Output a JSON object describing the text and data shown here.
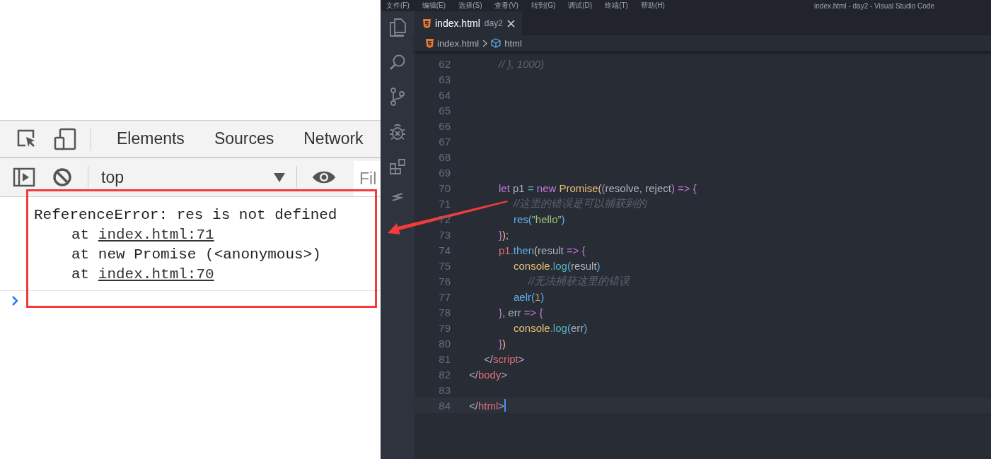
{
  "devtools": {
    "tabs": [
      {
        "label": "Elements"
      },
      {
        "label": "Sources"
      },
      {
        "label": "Network"
      }
    ],
    "toolbar": {
      "context": "top",
      "filter_placeholder": "Fil"
    },
    "console": {
      "message": "ReferenceError: res is not defined",
      "stack": [
        {
          "prefix": "at ",
          "link": "index.html:71"
        },
        {
          "prefix": "at new Promise (<anonymous>)"
        },
        {
          "prefix": "at ",
          "link": "index.html:70"
        }
      ]
    }
  },
  "vscode": {
    "menu": [
      "文件(F)",
      "编辑(E)",
      "选择(S)",
      "查看(V)",
      "转到(G)",
      "调试(D)",
      "终端(T)",
      "帮助(H)"
    ],
    "title": "index.html - day2 - Visual Studio Code",
    "tabs": [
      {
        "label": "index.html",
        "description": "day2",
        "selected": true
      }
    ],
    "breadcrumb": [
      {
        "label": "index.html",
        "kind": "file"
      },
      {
        "label": "html",
        "kind": "element"
      }
    ],
    "lines": [
      {
        "number": "62",
        "current": false,
        "tokens": [
          {
            "text": "\t\t// }, 1000)",
            "kind": "comment"
          }
        ]
      },
      {
        "number": "63",
        "current": false
      },
      {
        "number": "64",
        "current": false
      },
      {
        "number": "65",
        "current": false
      },
      {
        "number": "66",
        "current": false
      },
      {
        "number": "67",
        "current": false
      },
      {
        "number": "68",
        "current": false
      },
      {
        "number": "69",
        "current": false
      },
      {
        "number": "70",
        "current": false,
        "tokens": [
          {
            "text": "\t\tlet",
            "kind": "keyword"
          },
          {
            "text": " p1 ",
            "kind": "plain"
          },
          {
            "text": "=",
            "kind": "operator"
          },
          {
            "text": " new",
            "kind": "keyword"
          },
          {
            "text": " Promise",
            "kind": "class"
          },
          {
            "text": "(",
            "kind": "class"
          },
          {
            "text": "(",
            "kind": "keyword"
          },
          {
            "text": "resolve, reject",
            "kind": "plain"
          },
          {
            "text": ")",
            "kind": "keyword"
          },
          {
            "text": " =>",
            "kind": "keyword"
          },
          {
            "text": " {",
            "kind": "keyword"
          }
        ]
      },
      {
        "number": "71",
        "current": false,
        "tokens": [
          {
            "text": "\t\t\t//这里的错误是可以捕获到的",
            "kind": "comment"
          }
        ]
      },
      {
        "number": "72",
        "current": false,
        "tokens": [
          {
            "text": "\t\t\tres",
            "kind": "function"
          },
          {
            "text": "(",
            "kind": "function"
          },
          {
            "text": "”hello”",
            "kind": "string"
          },
          {
            "text": ")",
            "kind": "function"
          }
        ]
      },
      {
        "number": "73",
        "current": false,
        "tokens": [
          {
            "text": "\t\t}",
            "kind": "keyword"
          },
          {
            "text": ")",
            "kind": "class"
          },
          {
            "text": ";",
            "kind": "plain"
          }
        ]
      },
      {
        "number": "74",
        "current": false,
        "tokens": [
          {
            "text": "\t\tp1",
            "kind": "tag"
          },
          {
            "text": ".then",
            "kind": "function"
          },
          {
            "text": "(",
            "kind": "class"
          },
          {
            "text": "result ",
            "kind": "plain"
          },
          {
            "text": "=>",
            "kind": "keyword"
          },
          {
            "text": " {",
            "kind": "keyword"
          }
        ]
      },
      {
        "number": "75",
        "current": false,
        "tokens": [
          {
            "text": "\t\t\tconsole",
            "kind": "class"
          },
          {
            "text": ".log",
            "kind": "operator"
          },
          {
            "text": "(",
            "kind": "function"
          },
          {
            "text": "result",
            "kind": "plain"
          },
          {
            "text": ")",
            "kind": "function"
          }
        ]
      },
      {
        "number": "76",
        "current": false,
        "tokens": [
          {
            "text": "\t\t\t\t//无法捕获这里的错误",
            "kind": "comment"
          }
        ]
      },
      {
        "number": "77",
        "current": false,
        "tokens": [
          {
            "text": "\t\t\taelr",
            "kind": "function"
          },
          {
            "text": "(",
            "kind": "function"
          },
          {
            "text": "1",
            "kind": "number"
          },
          {
            "text": ")",
            "kind": "function"
          }
        ]
      },
      {
        "number": "78",
        "current": false,
        "tokens": [
          {
            "text": "\t\t}",
            "kind": "keyword"
          },
          {
            "text": ", err ",
            "kind": "plain"
          },
          {
            "text": "=>",
            "kind": "keyword"
          },
          {
            "text": " {",
            "kind": "keyword"
          }
        ]
      },
      {
        "number": "79",
        "current": false,
        "tokens": [
          {
            "text": "\t\t\tconsole",
            "kind": "class"
          },
          {
            "text": ".log",
            "kind": "operator"
          },
          {
            "text": "(",
            "kind": "function"
          },
          {
            "text": "err",
            "kind": "plain"
          },
          {
            "text": ")",
            "kind": "function"
          }
        ]
      },
      {
        "number": "80",
        "current": false,
        "tokens": [
          {
            "text": "\t\t}",
            "kind": "keyword"
          },
          {
            "text": ")",
            "kind": "class"
          }
        ]
      },
      {
        "number": "81",
        "current": false,
        "tokens": [
          {
            "text": "\t</",
            "kind": "plain"
          },
          {
            "text": "script",
            "kind": "tag"
          },
          {
            "text": ">",
            "kind": "plain"
          }
        ]
      },
      {
        "number": "82",
        "current": false,
        "tokens": [
          {
            "text": "</",
            "kind": "plain"
          },
          {
            "text": "body",
            "kind": "tag"
          },
          {
            "text": ">",
            "kind": "plain"
          }
        ]
      },
      {
        "number": "83",
        "current": false
      },
      {
        "number": "84",
        "current": true,
        "tokens": [
          {
            "text": "</",
            "kind": "plain"
          },
          {
            "text": "html",
            "kind": "tag"
          },
          {
            "text": ">",
            "kind": "plain"
          }
        ]
      }
    ]
  }
}
